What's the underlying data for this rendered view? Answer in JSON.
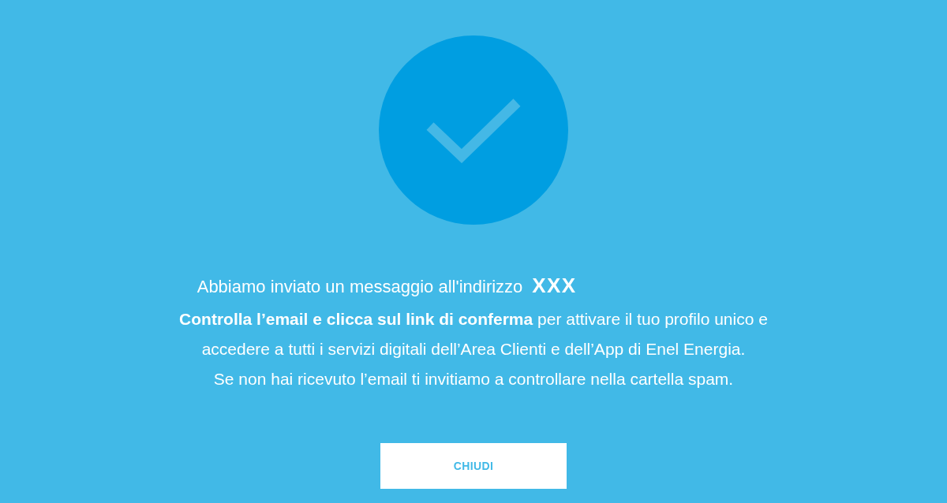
{
  "confirmation": {
    "intro": "Abbiamo inviato un messaggio all'indirizzo",
    "email": "XXX",
    "lines": [
      "**Controlla l’email e clicca sul link di conferma** per attivare il tuo profilo unico e",
      "accedere a tutti i servizi digitali dell’Area Clienti e dell’App di Enel Energia.",
      "Se non hai ricevuto l’email ti invitiamo a controllare nella cartella spam."
    ],
    "button": "CHIUDI"
  }
}
